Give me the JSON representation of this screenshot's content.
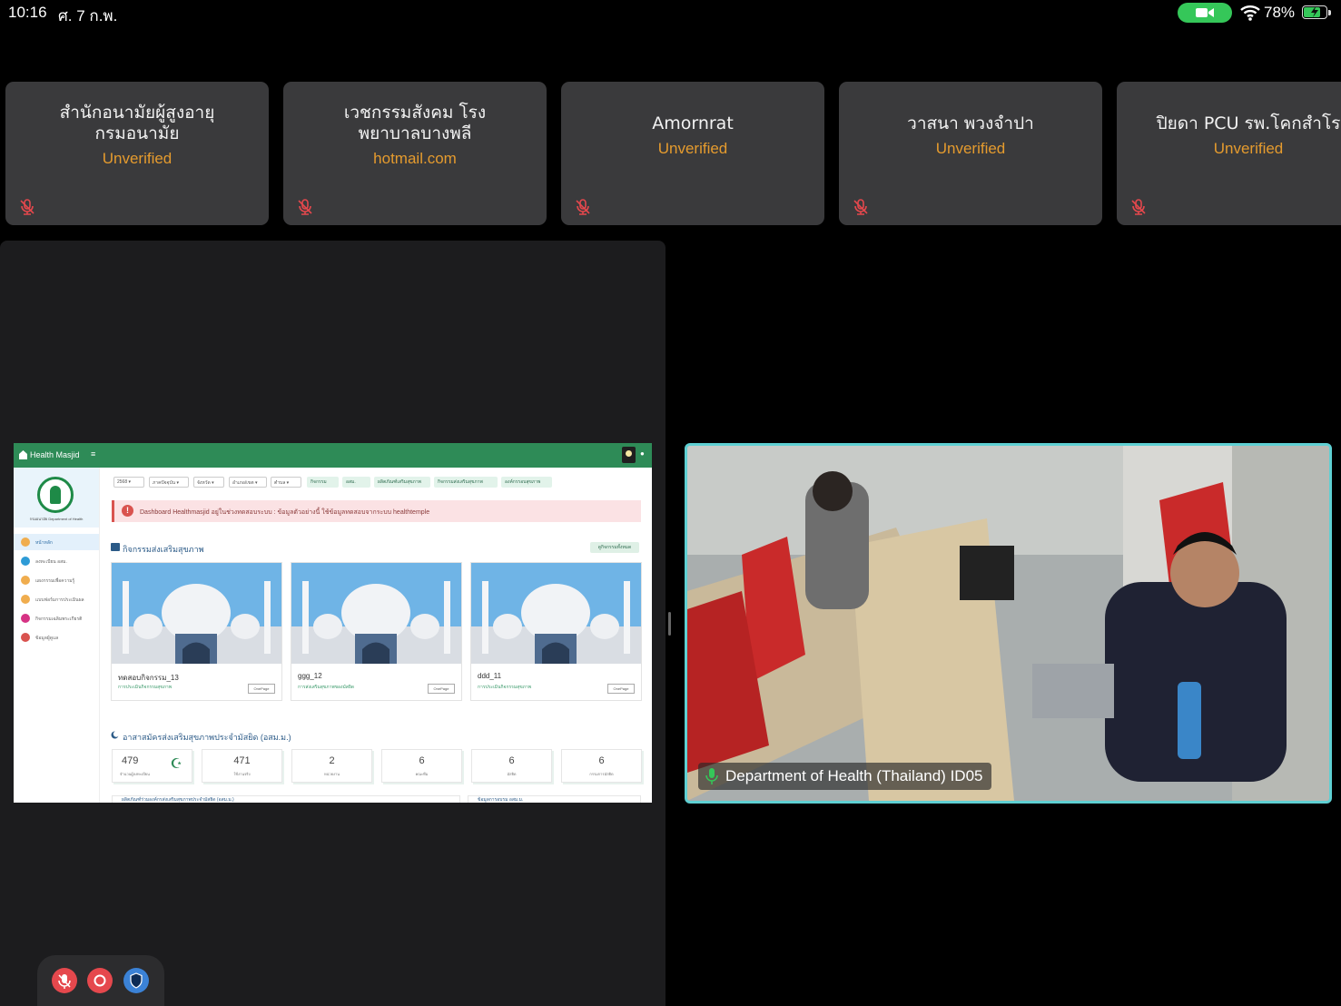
{
  "status_bar": {
    "time": "10:16",
    "date": "ศ. 7 ก.พ.",
    "battery_percent": "78%",
    "battery_level": 0.78,
    "camera_pill_color": "#35c759"
  },
  "participants": [
    {
      "name": "สำนักอนามัยผู้สูงอายุ\nกรมอนามัย",
      "sub": "Unverified",
      "mic": "mic-muted-icon"
    },
    {
      "name": "เวชกรรมสังคม โรง\nพยาบาลบางพลี",
      "sub": "hotmail.com",
      "mic": "mic-muted-icon"
    },
    {
      "name": "Amornrat",
      "sub": "Unverified",
      "mic": "mic-muted-icon"
    },
    {
      "name": "วาสนา พวงจำปา",
      "sub": "Unverified",
      "mic": "mic-muted-icon"
    },
    {
      "name": "ปิยดา PCU รพ.โคกสำโร",
      "sub": "Unverified",
      "mic": "mic-muted-icon"
    }
  ],
  "shared_screen": {
    "brand": "Health Masjid",
    "menu_icon": "≡",
    "sidebar": [
      {
        "label": "หน้าหลัก",
        "color": "#f0ad4e",
        "active": true
      },
      {
        "label": "ลงทะเบียน อสม.",
        "color": "#2e9bd6"
      },
      {
        "label": "แผงกรรมเพื่อความรู้",
        "color": "#f0ad4e"
      },
      {
        "label": "แบบฟอร์มการประเมินผล",
        "color": "#f0ad4e"
      },
      {
        "label": "กิจกรรมเฉลิมพระเกียรติ",
        "color": "#d63384"
      },
      {
        "label": "ข้อมูลผู้ดูแล",
        "color": "#d9534f"
      }
    ],
    "logo_caption": "กรมอนามัย Department of Health",
    "filters": [
      "2568",
      "ภาคปัจจุบัน",
      "จังหวัด",
      "อำเภอ/เขต",
      "ตำบล"
    ],
    "filter_buttons": [
      "กิจกรรม",
      "อสม.",
      "ผลิตภัณฑ์เสริมสุขภาพ",
      "กิจกรรมส่งเสริมสุขภาพ",
      "องค์กรรอบสุขภาพ"
    ],
    "alert": "Dashboard Healthmasjid อยู่ในช่วงทดสอบระบบ : ข้อมูลตัวอย่างนี้ ใช้ข้อมูลทดสอบจากระบบ healthtemple",
    "section1_title": "กิจกรรมส่งเสริมสุขภาพ",
    "section1_button": "ดูกิจกรรมทั้งหมด",
    "cards": [
      {
        "name": "ทดสอบกิจกรรม_13",
        "tag": "การประเมินกิจกรรมสุขภาพ",
        "button": "OnePage"
      },
      {
        "name": "ggg_12",
        "tag": "การส่งเสริมสุขภาพของมัสยิด",
        "button": "OnePage"
      },
      {
        "name": "ddd_11",
        "tag": "การประเมินกิจกรรมสุขภาพ",
        "button": "OnePage"
      }
    ],
    "section2_title": "อาสาสมัครส่งเสริมสุขภาพประจำมัสยิด (อสม.ม.)",
    "stats": [
      {
        "value": "479",
        "label": "จำนวนผู้ลงทะเบียน"
      },
      {
        "value": "471",
        "label": "ใช้งานจริง"
      },
      {
        "value": "2",
        "label": "หน่วยงาน"
      },
      {
        "value": "6",
        "label": "คณะทีม"
      },
      {
        "value": "6",
        "label": "มัสยิด"
      },
      {
        "value": "6",
        "label": "กรรมการมัสยิด"
      }
    ],
    "bottom_sections": [
      "ผลิตภัณฑ์ร่วมองค์กรส่งเสริมสุขภาพประจำมัสยิด (อสม.ม.)",
      "ข้อมูลการอบรม อสม.ม."
    ]
  },
  "video": {
    "label": "Department of Health (Thailand) ID05",
    "border_color": "#5fd0d3"
  },
  "controls": [
    {
      "name": "mute-button",
      "icon": "mic-muted-icon",
      "color": "#e5484d"
    },
    {
      "name": "record-button",
      "icon": "record-icon",
      "color": "#e5484d"
    },
    {
      "name": "security-button",
      "icon": "shield-icon",
      "color": "#3b82d6"
    }
  ]
}
